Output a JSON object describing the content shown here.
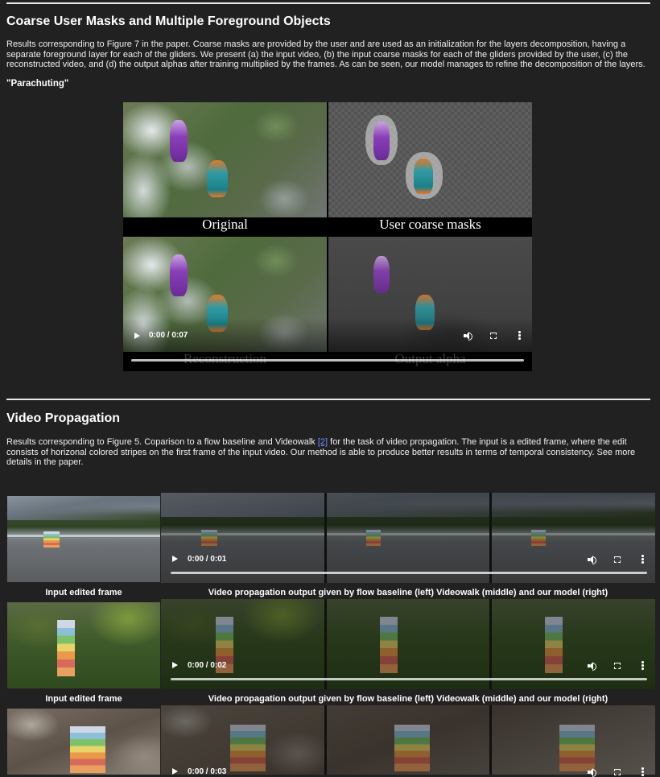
{
  "section1": {
    "heading": "Coarse User Masks and Multiple Foreground Objects",
    "description": "Results corresponding to Figure 7 in the paper. Coarse masks are provided by the user and are used as an initialization for the layers decomposition, having a separate foreground layer for each of the gliders. We present (a) the input video, (b) the input coarse masks for each of the gliders provided by the user, (c) the reconstructed video, and (d) the output alphas after training multiplied by the frames. As can be seen, our model manages to refine the decomposition of the layers.",
    "example_title": "\"Parachuting\"",
    "video": {
      "labels": [
        "Original",
        "User coarse masks",
        "Reconstruction",
        "Output alpha"
      ],
      "time": "0:00 / 0:07"
    }
  },
  "section2": {
    "heading": "Video Propagation",
    "description_before_link": "Results corresponding to Figure 5. Coparison to a flow baseline and Videowalk ",
    "link_text": "[2]",
    "description_after_link": " for the task of video propagation. The input is a edited frame, where the edit consists of horizonal colored stripes on the first frame of the input video. Our method is able to produce better results in terms of temporal consistency. See more details in the paper.",
    "rows": [
      {
        "input_caption": "Input edited frame",
        "output_caption": "Video propagation output given by flow baseline (left) Videowalk (middle) and our model (right)",
        "time": "0:00 / 0:01"
      },
      {
        "input_caption": "Input edited frame",
        "output_caption": "Video propagation output given by flow baseline (left) Videowalk (middle) and our model (right)",
        "time": "0:00 / 0:02"
      },
      {
        "time": "0:00 / 0:03"
      }
    ]
  }
}
